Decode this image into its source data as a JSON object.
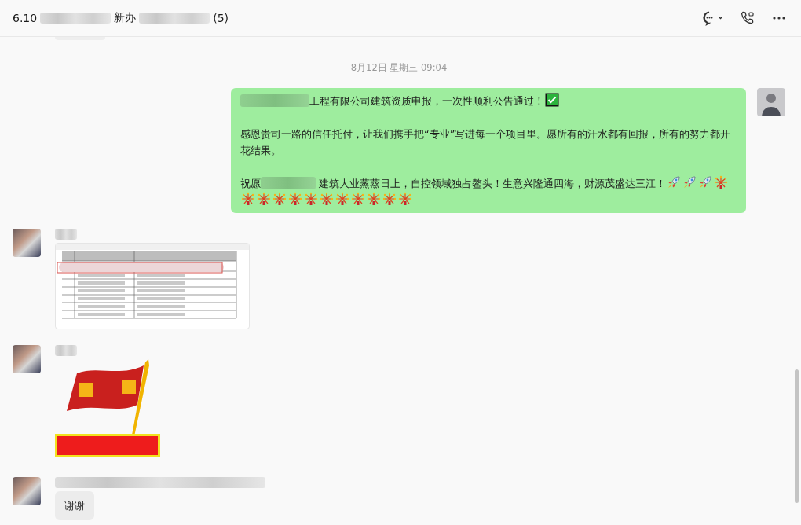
{
  "header": {
    "title_parts": [
      {
        "kind": "text",
        "text": "6.10"
      },
      {
        "kind": "blur"
      },
      {
        "kind": "text",
        "text": "新办"
      },
      {
        "kind": "blur"
      },
      {
        "kind": "text",
        "text": "(5)"
      }
    ]
  },
  "timestamp": "8月12日 星期三 09:04",
  "messages": [
    {
      "kind": "text",
      "mine": true,
      "paragraphs": [
        [
          {
            "kind": "blur"
          },
          {
            "kind": "text",
            "text": "工程有限公司建筑资质申报，一次性顺利公告通过！"
          },
          {
            "kind": "check"
          }
        ],
        [
          {
            "kind": "text",
            "text": "感恩贵司一路的信任托付，让我们携手把“专业”写进每一个项目里。愿所有的汗水都有回报，所有的努力都开花结果。"
          }
        ],
        [
          {
            "kind": "text",
            "text": "祝愿"
          },
          {
            "kind": "blur"
          },
          {
            "kind": "text",
            "text": " 建筑大业蒸蒸日上，自控领域独占鳌头！生意兴隆通四海，财源茂盛达三江！"
          },
          {
            "kind": "rocket"
          },
          {
            "kind": "rocket"
          },
          {
            "kind": "rocket"
          },
          {
            "kind": "firework"
          },
          {
            "kind": "firework"
          },
          {
            "kind": "firework"
          },
          {
            "kind": "firework"
          },
          {
            "kind": "firework"
          },
          {
            "kind": "firework"
          },
          {
            "kind": "firework"
          },
          {
            "kind": "firework"
          },
          {
            "kind": "firework"
          },
          {
            "kind": "firework"
          },
          {
            "kind": "firework"
          },
          {
            "kind": "firework"
          }
        ]
      ]
    },
    {
      "kind": "spreadsheet",
      "mine": false
    },
    {
      "kind": "sticker",
      "mine": false
    },
    {
      "kind": "text",
      "mine": false,
      "paragraphs": [
        [
          {
            "kind": "text",
            "text": "谢谢"
          }
        ]
      ]
    }
  ]
}
